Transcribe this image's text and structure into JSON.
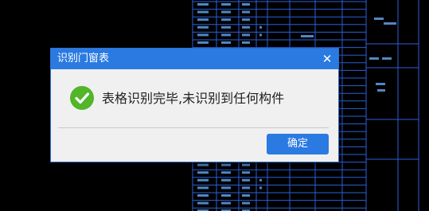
{
  "dialog": {
    "title": "识别门窗表",
    "close_glyph": "✕",
    "message": "表格识别完毕,未识别到任何构件",
    "ok_label": "确定",
    "icon": "success-check-icon"
  },
  "colors": {
    "cad_background": "#000000",
    "cad_line": "#2b5fd9",
    "cad_text": "#6fb3ff",
    "title_bar": "#2a7ae2",
    "dialog_body": "#f0f0f0",
    "success_green": "#53b52a",
    "button": "#2a7ae2"
  }
}
